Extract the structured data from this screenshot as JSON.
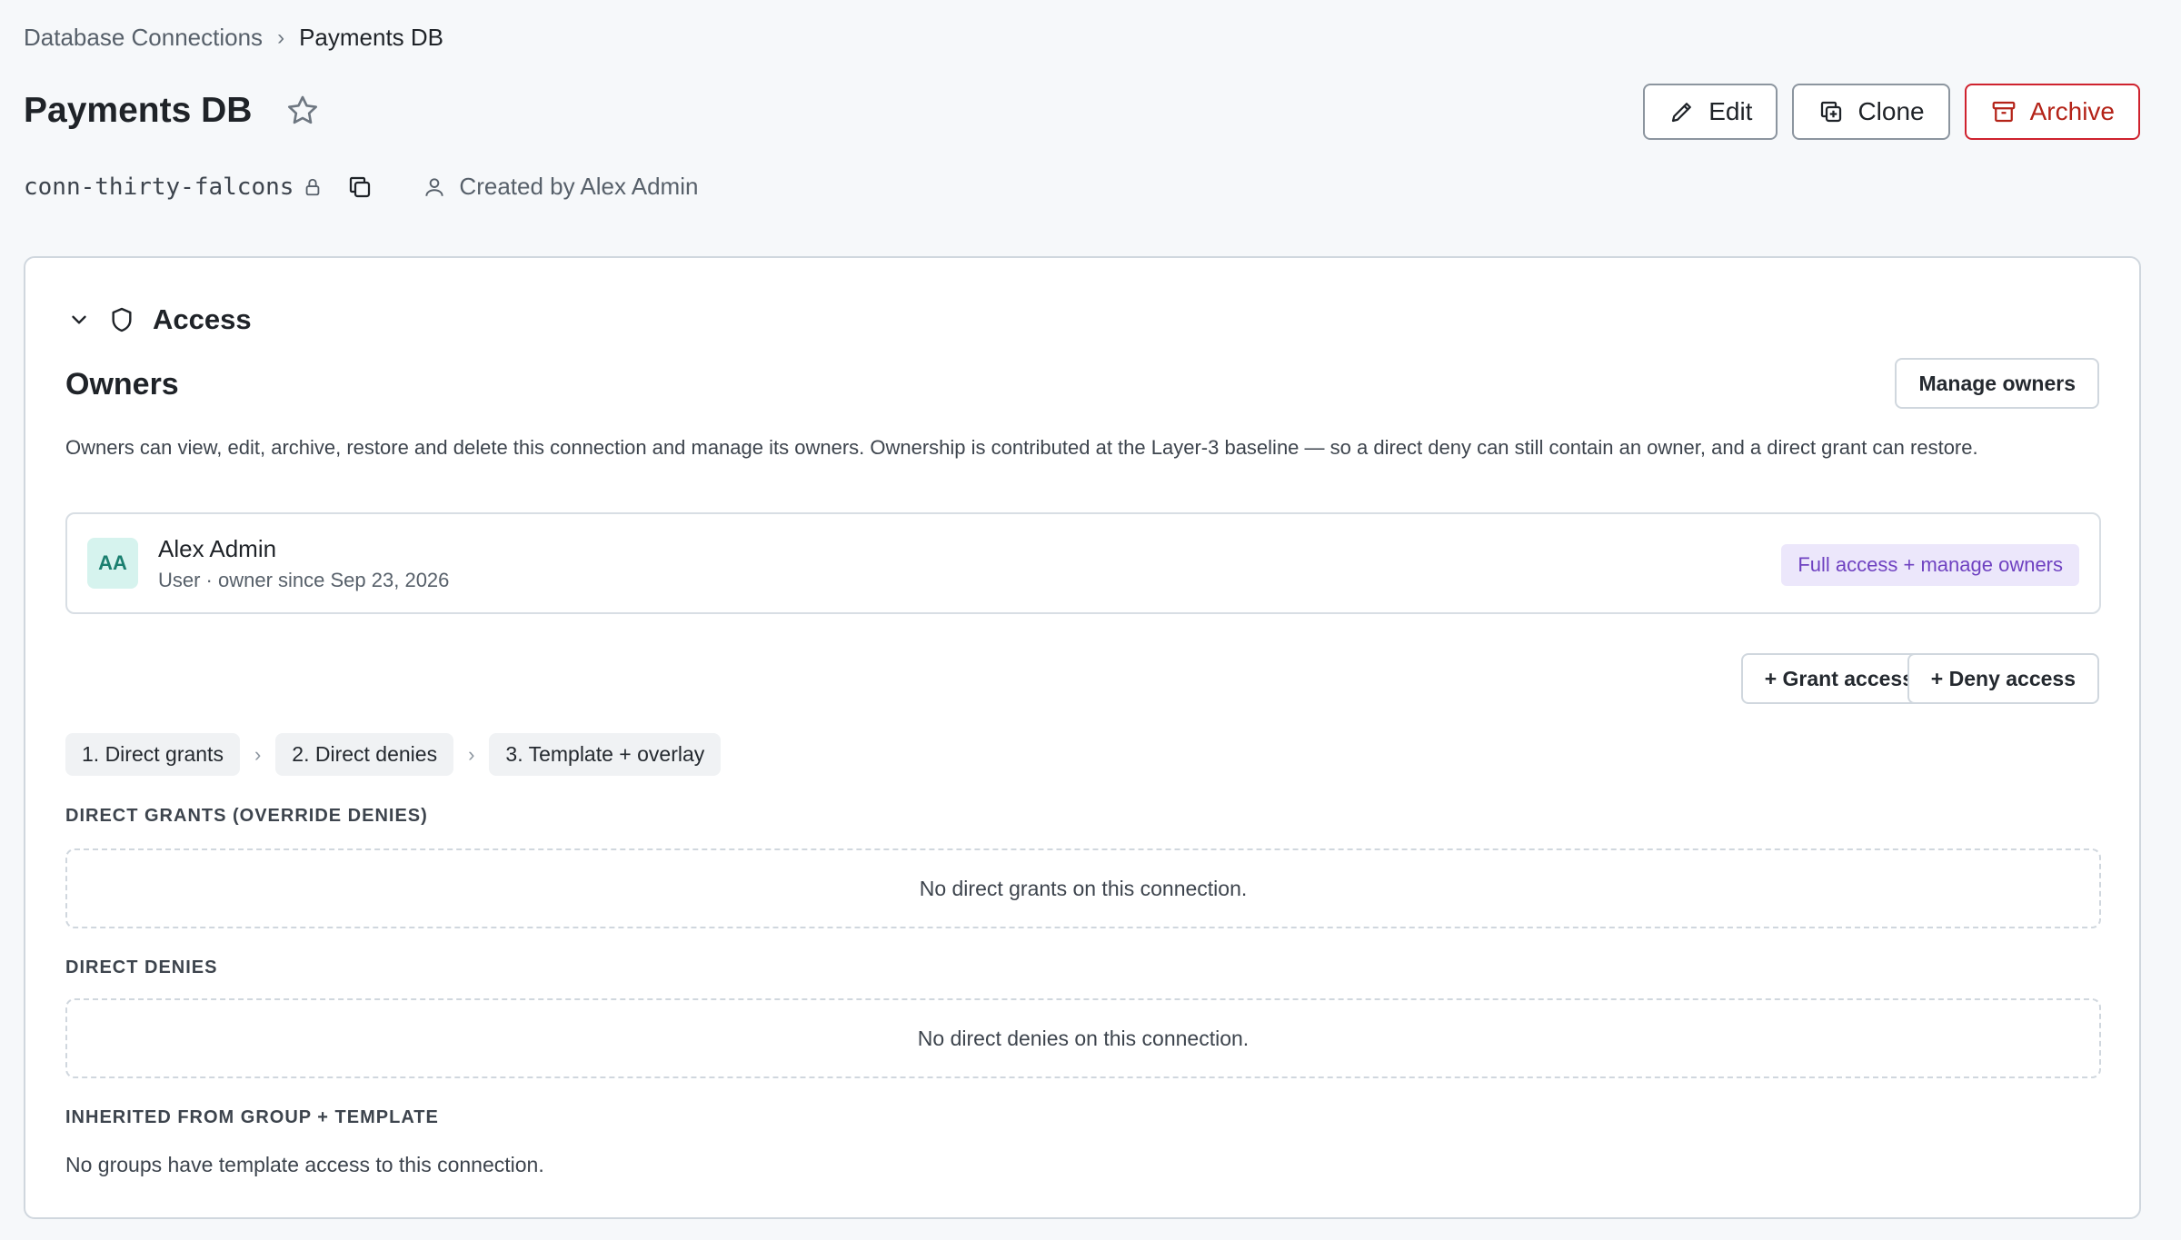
{
  "breadcrumb": {
    "parent": "Database Connections",
    "separator": "›",
    "current": "Payments DB"
  },
  "header": {
    "title": "Payments DB",
    "favorite_icon": "star-outline-icon",
    "connection_id": "conn-thirty-falcons",
    "created_by": "Created by Alex Admin",
    "actions": {
      "edit": "Edit",
      "clone": "Clone",
      "archive": "Archive"
    }
  },
  "access": {
    "section_title": "Access",
    "owners": {
      "title": "Owners",
      "manage_button": "Manage owners",
      "description": "Owners can view, edit, archive, restore and delete this connection and manage its owners. Ownership is contributed at the Layer-3 baseline — so a direct deny can still contain an owner, and a direct grant can restore.",
      "list": [
        {
          "initials": "AA",
          "name": "Alex Admin",
          "subtitle": "User · owner since Sep 23, 2026",
          "badge": "Full access + manage owners"
        }
      ]
    },
    "grant_button": "+ Grant access",
    "deny_button": "+ Deny access",
    "steps": [
      "1. Direct grants",
      "2. Direct denies",
      "3. Template + overlay"
    ],
    "step_separator": "›",
    "direct_grants": {
      "title": "DIRECT GRANTS (OVERRIDE DENIES)",
      "empty": "No direct grants on this connection."
    },
    "direct_denies": {
      "title": "DIRECT DENIES",
      "empty": "No direct denies on this connection."
    },
    "inherited": {
      "title": "INHERITED FROM GROUP + TEMPLATE",
      "empty": "No groups have template access to this connection."
    }
  },
  "colors": {
    "danger": "#cf222e",
    "badge_bg": "#ece7fb",
    "badge_text": "#6f42c1",
    "avatar_bg": "#d6f3ee",
    "avatar_text": "#1a7f6f"
  }
}
